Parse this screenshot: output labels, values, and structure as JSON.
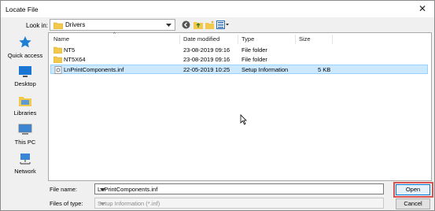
{
  "window": {
    "title": "Locate File",
    "close_glyph": "✕"
  },
  "lookin": {
    "label": "Look in:",
    "value": "Drivers"
  },
  "places": [
    {
      "label": "Quick access",
      "icon": "quick-access-star-icon"
    },
    {
      "label": "Desktop",
      "icon": "desktop-icon"
    },
    {
      "label": "Libraries",
      "icon": "libraries-icon"
    },
    {
      "label": "This PC",
      "icon": "this-pc-icon"
    },
    {
      "label": "Network",
      "icon": "network-icon"
    }
  ],
  "columns": {
    "name": "Name",
    "date": "Date modified",
    "type": "Type",
    "size": "Size"
  },
  "files": [
    {
      "name": "NT5",
      "date": "23-08-2019 09:16",
      "type": "File folder",
      "size": ""
    },
    {
      "name": "NT5X64",
      "date": "23-08-2019 09:16",
      "type": "File folder",
      "size": ""
    },
    {
      "name": "LnPrintComponents.inf",
      "date": "22-05-2019 10:25",
      "type": "Setup Information",
      "size": "5 KB"
    }
  ],
  "filename": {
    "label": "File name:",
    "value": "LnPrintComponents.inf"
  },
  "filetype": {
    "label": "Files of type:",
    "value": "Setup Information (*.inf)"
  },
  "buttons": {
    "open": "Open",
    "cancel": "Cancel"
  },
  "colors": {
    "selection": "#cce8ff",
    "highlight": "#d9534f",
    "folder": "#f2c94c"
  }
}
